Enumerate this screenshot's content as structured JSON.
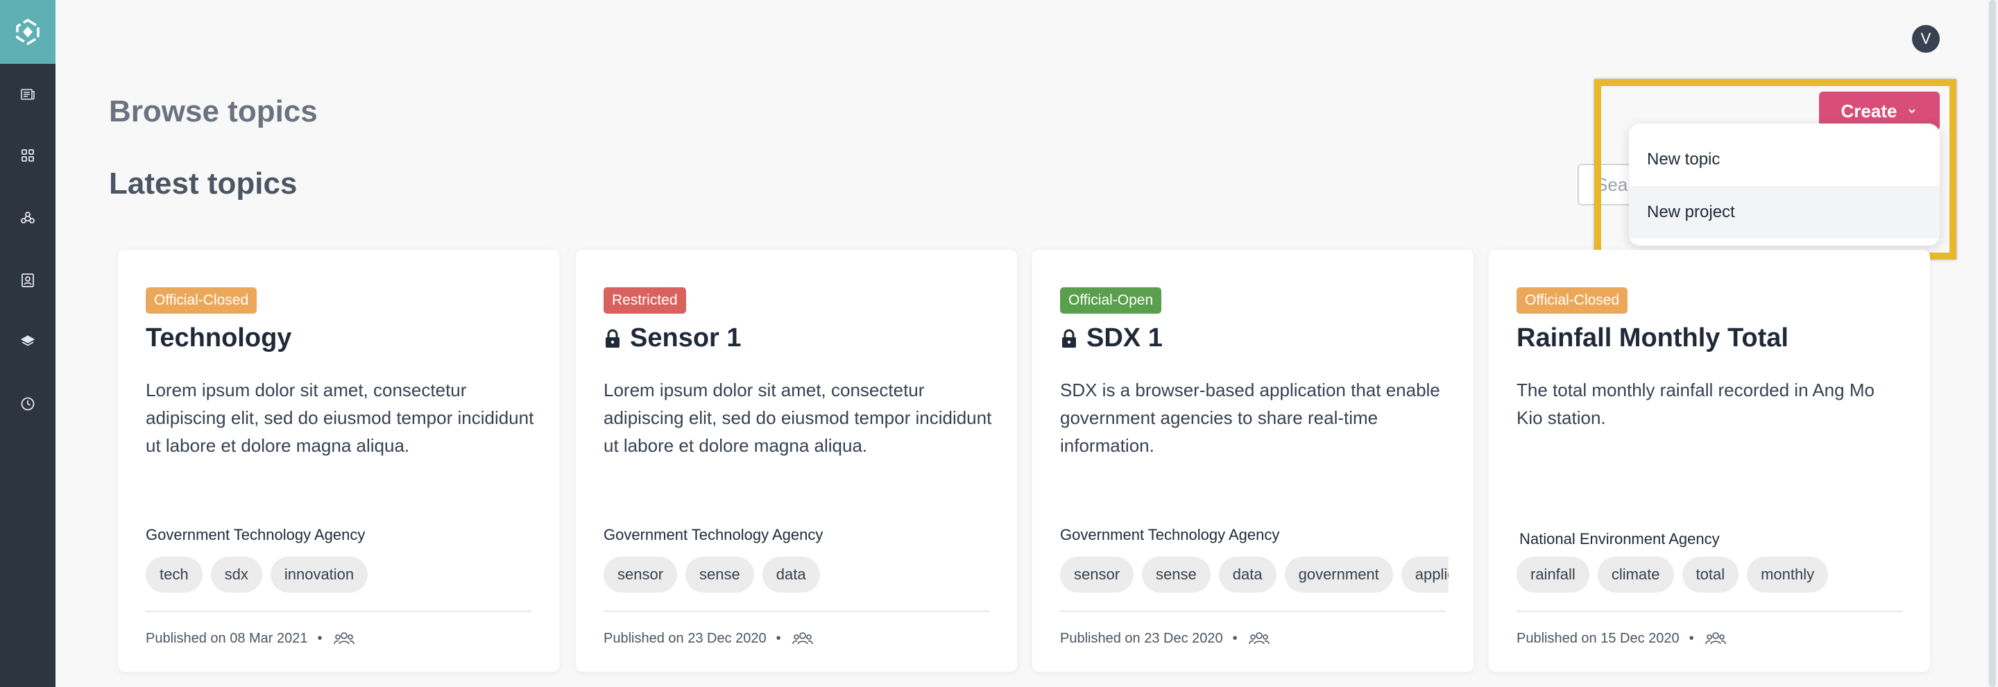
{
  "header": {
    "avatar_initial": "V"
  },
  "page": {
    "title": "Browse topics",
    "section_title": "Latest topics"
  },
  "search": {
    "placeholder": "Search"
  },
  "create": {
    "label": "Create",
    "menu": [
      "New topic",
      "New project"
    ]
  },
  "sidebar": {
    "icons": [
      "newspaper-icon",
      "grid-icon",
      "network-icon",
      "contact-card-icon",
      "layers-icon",
      "clock-icon"
    ]
  },
  "colors": {
    "sidebar": "#2d3540",
    "logo_bg": "#5eb0b5",
    "accent": "#d84d79",
    "official_closed": "#eca85a",
    "restricted": "#d9625e",
    "official_open": "#5a9f4d",
    "highlight": "#e6b82b"
  },
  "cards": [
    {
      "badge": "Official-Closed",
      "title": "Technology",
      "description": "Lorem ipsum dolor sit amet, consectetur adipiscing elit, sed do eiusmod tempor incididunt ut labore et dolore magna aliqua.",
      "agency": "Government Technology Agency",
      "tags": [
        "tech",
        "sdx",
        "innovation"
      ],
      "published": "Published on 08 Mar 2021"
    },
    {
      "badge": "Restricted",
      "title": "Sensor 1",
      "description": "Lorem ipsum dolor sit amet, consectetur adipiscing elit, sed do eiusmod tempor incididunt ut labore et dolore magna aliqua.",
      "agency": "Government Technology Agency",
      "tags": [
        "sensor",
        "sense",
        "data"
      ],
      "published": "Published on 23 Dec 2020"
    },
    {
      "badge": "Official-Open",
      "title": "SDX 1",
      "description": "SDX is a browser-based application that enable government agencies to share real-time information.",
      "agency": "Government Technology Agency",
      "tags": [
        "sensor",
        "sense",
        "data",
        "government",
        "application"
      ],
      "published": "Published on 23 Dec 2020"
    },
    {
      "badge": "Official-Closed",
      "title": "Rainfall Monthly Total",
      "description": "The total monthly rainfall recorded in Ang Mo Kio station.",
      "agency": "National Environment Agency",
      "tags": [
        "rainfall",
        "climate",
        "total",
        "monthly"
      ],
      "published": "Published on 15 Dec 2020"
    }
  ]
}
